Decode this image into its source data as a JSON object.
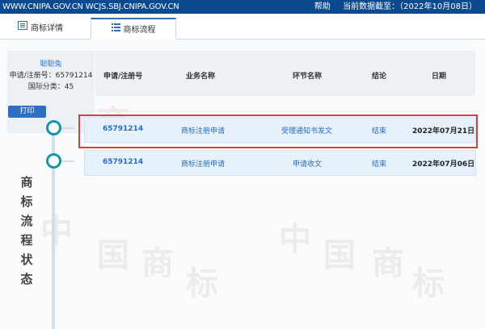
{
  "topbar": {
    "domains": "WWW.CNIPA.GOV.CN WCJS.SBJ.CNIPA.GOV.CN",
    "help": "帮助",
    "data_date_label": "当前数据截至：",
    "data_date": "（2022年10月08日）"
  },
  "tabs": [
    {
      "label": "商标详情",
      "icon": "document-list-icon",
      "active": false
    },
    {
      "label": "商标流程",
      "icon": "list-icon",
      "active": true
    }
  ],
  "summary": {
    "owner": "聪聪兔",
    "reg_label": "申请/注册号：",
    "reg_number": "65791214",
    "class_label": "国际分类：",
    "class": "45"
  },
  "columns": [
    "申请/注册号",
    "业务名称",
    "环节名称",
    "结论",
    "日期"
  ],
  "print_label": "打印",
  "vertical_title": [
    "商",
    "标",
    "流",
    "程",
    "状",
    "态"
  ],
  "rows": [
    {
      "reg_number": "65791214",
      "business": "商标注册申请",
      "step": "受理通知书发文",
      "result": "结束",
      "date": "2022年07月21日",
      "highlighted": true
    },
    {
      "reg_number": "65791214",
      "business": "商标注册申请",
      "step": "申请收文",
      "result": "结束",
      "date": "2022年07月06日",
      "highlighted": false
    }
  ],
  "watermark": [
    "中",
    "国",
    "商",
    "标"
  ],
  "colors": {
    "topbar": "#0b4a8f",
    "accent": "#2f6fc2",
    "timeline": "#1795a8",
    "highlight": "#d9403a"
  }
}
